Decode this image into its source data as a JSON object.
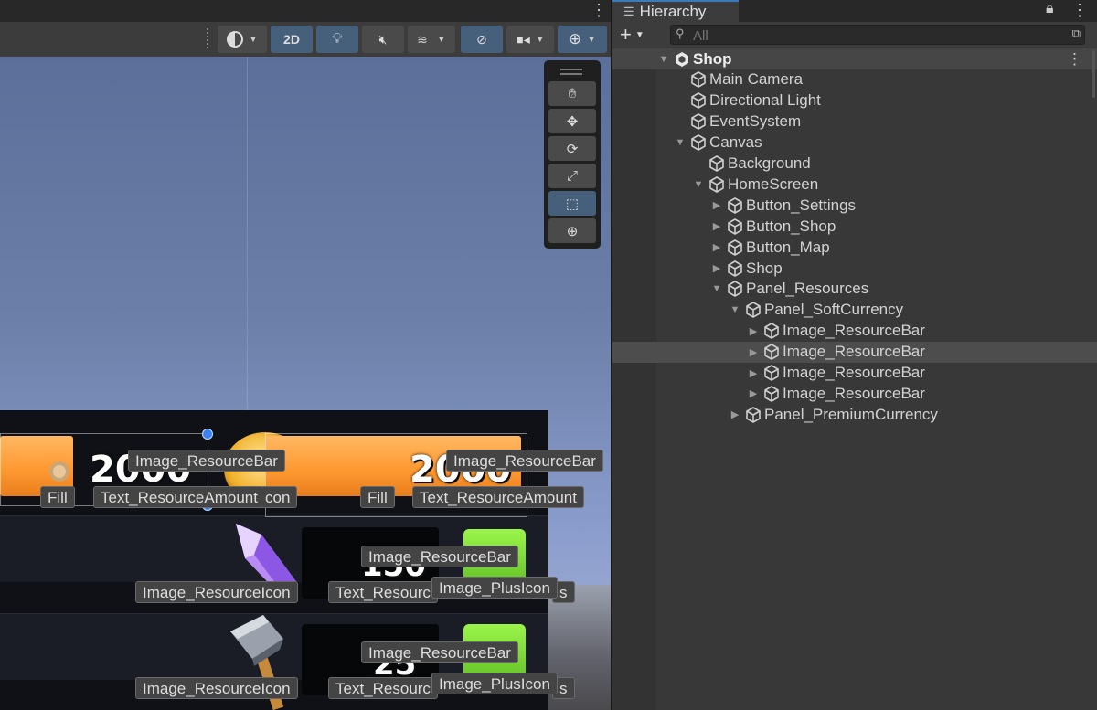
{
  "scene": {
    "toolbar": {
      "draw_mode_icon": "shading-sphere-icon",
      "mode_2d_label": "2D",
      "lighting_icon": "lightbulb-icon",
      "audio_icon": "audio-mute-icon",
      "effects_icon": "effects-layers-icon",
      "hidden_objects_icon": "visibility-off-icon",
      "camera_icon": "camera-icon",
      "gizmos_icon": "gizmo-globe-icon"
    },
    "tools": [
      {
        "name": "hand-tool",
        "glyph": "✋"
      },
      {
        "name": "move-tool",
        "glyph": "✥"
      },
      {
        "name": "rotate-tool",
        "glyph": "⟳"
      },
      {
        "name": "scale-tool",
        "glyph": "⤢"
      },
      {
        "name": "rect-tool",
        "glyph": "⬚"
      },
      {
        "name": "transform-tool",
        "glyph": "⊕"
      }
    ],
    "canvas": {
      "amount_1": "2000",
      "amount_2": "2000",
      "amount_3": "150",
      "amount_4": "25"
    },
    "labels": {
      "image_resource_bar_1": "Image_ResourceBar",
      "image_resource_bar_2": "Image_ResourceBar",
      "fill_1": "Fill",
      "text_resource_amount_1": "Text_ResourceAmount",
      "icon_suffix": "con",
      "fill_2": "Fill",
      "text_resource_amount_2": "Text_ResourceAmount",
      "image_resource_bar_3": "Image_ResourceBar",
      "image_resource_icon_1": "Image_ResourceIcon",
      "text_resource_partial_1": "Text_Resourc",
      "image_plus_icon_1": "Image_PlusIcon",
      "tail_s_1": "s",
      "image_resource_bar_4": "Image_ResourceBar",
      "image_resource_icon_2": "Image_ResourceIcon",
      "text_resource_partial_2": "Text_Resourc",
      "image_plus_icon_2": "Image_PlusIcon",
      "tail_s_2": "s"
    }
  },
  "hierarchy": {
    "tab_label": "Hierarchy",
    "add_label": "+",
    "search_placeholder": "All",
    "items": [
      {
        "label": "Shop",
        "depth": 0,
        "expanded": true,
        "root": true
      },
      {
        "label": "Main Camera",
        "depth": 1
      },
      {
        "label": "Directional Light",
        "depth": 1
      },
      {
        "label": "EventSystem",
        "depth": 1
      },
      {
        "label": "Canvas",
        "depth": 1,
        "expanded": true
      },
      {
        "label": "Background",
        "depth": 2
      },
      {
        "label": "HomeScreen",
        "depth": 2,
        "expanded": true
      },
      {
        "label": "Button_Settings",
        "depth": 3,
        "collapsed": true
      },
      {
        "label": "Button_Shop",
        "depth": 3,
        "collapsed": true
      },
      {
        "label": "Button_Map",
        "depth": 3,
        "collapsed": true
      },
      {
        "label": "Shop",
        "depth": 3,
        "collapsed": true
      },
      {
        "label": "Panel_Resources",
        "depth": 3,
        "expanded": true
      },
      {
        "label": "Panel_SoftCurrency",
        "depth": 4,
        "expanded": true
      },
      {
        "label": "Image_ResourceBar",
        "depth": 5,
        "collapsed": true
      },
      {
        "label": "Image_ResourceBar",
        "depth": 5,
        "collapsed": true,
        "selected": true
      },
      {
        "label": "Image_ResourceBar",
        "depth": 5,
        "collapsed": true
      },
      {
        "label": "Image_ResourceBar",
        "depth": 5,
        "collapsed": true
      },
      {
        "label": "Panel_PremiumCurrency",
        "depth": 4,
        "collapsed": true
      }
    ]
  }
}
